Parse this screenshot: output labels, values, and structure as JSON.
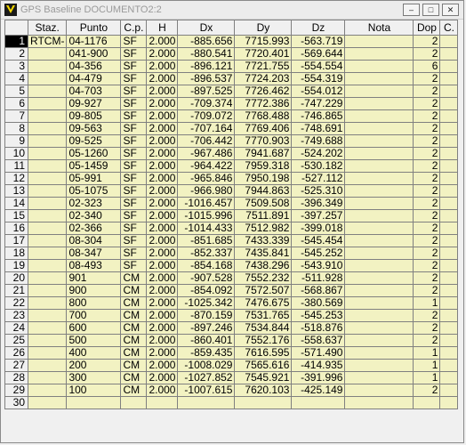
{
  "window": {
    "title": "GPS Baseline DOCUMENTO2:2"
  },
  "titlebar_buttons": {
    "minimize": "–",
    "restore": "□",
    "close": "✕"
  },
  "table": {
    "columns": [
      "",
      "Staz.",
      "Punto",
      "C.p.",
      "H",
      "Dx",
      "Dy",
      "Dz",
      "Nota",
      "Dop",
      "C."
    ],
    "rows": [
      {
        "n": "1",
        "staz": "RTCM-",
        "punto": "04-1176",
        "cp": "SF",
        "h": "2.000",
        "dx": "-885.656",
        "dy": "7715.993",
        "dz": "-563.719",
        "nota": "",
        "dop": "2",
        "c": ""
      },
      {
        "n": "2",
        "staz": "",
        "punto": "041-900",
        "cp": "SF",
        "h": "2.000",
        "dx": "-880.541",
        "dy": "7720.401",
        "dz": "-569.644",
        "nota": "",
        "dop": "2",
        "c": ""
      },
      {
        "n": "3",
        "staz": "",
        "punto": "04-356",
        "cp": "SF",
        "h": "2.000",
        "dx": "-896.121",
        "dy": "7721.755",
        "dz": "-554.554",
        "nota": "",
        "dop": "6",
        "c": ""
      },
      {
        "n": "4",
        "staz": "",
        "punto": "04-479",
        "cp": "SF",
        "h": "2.000",
        "dx": "-896.537",
        "dy": "7724.203",
        "dz": "-554.319",
        "nota": "",
        "dop": "2",
        "c": ""
      },
      {
        "n": "5",
        "staz": "",
        "punto": "04-703",
        "cp": "SF",
        "h": "2.000",
        "dx": "-897.525",
        "dy": "7726.462",
        "dz": "-554.012",
        "nota": "",
        "dop": "2",
        "c": ""
      },
      {
        "n": "6",
        "staz": "",
        "punto": "09-927",
        "cp": "SF",
        "h": "2.000",
        "dx": "-709.374",
        "dy": "7772.386",
        "dz": "-747.229",
        "nota": "",
        "dop": "2",
        "c": ""
      },
      {
        "n": "7",
        "staz": "",
        "punto": "09-805",
        "cp": "SF",
        "h": "2.000",
        "dx": "-709.072",
        "dy": "7768.488",
        "dz": "-746.865",
        "nota": "",
        "dop": "2",
        "c": ""
      },
      {
        "n": "8",
        "staz": "",
        "punto": "09-563",
        "cp": "SF",
        "h": "2.000",
        "dx": "-707.164",
        "dy": "7769.406",
        "dz": "-748.691",
        "nota": "",
        "dop": "2",
        "c": ""
      },
      {
        "n": "9",
        "staz": "",
        "punto": "09-525",
        "cp": "SF",
        "h": "2.000",
        "dx": "-706.442",
        "dy": "7770.903",
        "dz": "-749.688",
        "nota": "",
        "dop": "2",
        "c": ""
      },
      {
        "n": "10",
        "staz": "",
        "punto": "05-1260",
        "cp": "SF",
        "h": "2.000",
        "dx": "-967.486",
        "dy": "7941.687",
        "dz": "-524.202",
        "nota": "",
        "dop": "2",
        "c": ""
      },
      {
        "n": "11",
        "staz": "",
        "punto": "05-1459",
        "cp": "SF",
        "h": "2.000",
        "dx": "-964.422",
        "dy": "7959.318",
        "dz": "-530.182",
        "nota": "",
        "dop": "2",
        "c": ""
      },
      {
        "n": "12",
        "staz": "",
        "punto": "05-991",
        "cp": "SF",
        "h": "2.000",
        "dx": "-965.846",
        "dy": "7950.198",
        "dz": "-527.112",
        "nota": "",
        "dop": "2",
        "c": ""
      },
      {
        "n": "13",
        "staz": "",
        "punto": "05-1075",
        "cp": "SF",
        "h": "2.000",
        "dx": "-966.980",
        "dy": "7944.863",
        "dz": "-525.310",
        "nota": "",
        "dop": "2",
        "c": ""
      },
      {
        "n": "14",
        "staz": "",
        "punto": "02-323",
        "cp": "SF",
        "h": "2.000",
        "dx": "-1016.457",
        "dy": "7509.508",
        "dz": "-396.349",
        "nota": "",
        "dop": "2",
        "c": ""
      },
      {
        "n": "15",
        "staz": "",
        "punto": "02-340",
        "cp": "SF",
        "h": "2.000",
        "dx": "-1015.996",
        "dy": "7511.891",
        "dz": "-397.257",
        "nota": "",
        "dop": "2",
        "c": ""
      },
      {
        "n": "16",
        "staz": "",
        "punto": "02-366",
        "cp": "SF",
        "h": "2.000",
        "dx": "-1014.433",
        "dy": "7512.982",
        "dz": "-399.018",
        "nota": "",
        "dop": "2",
        "c": ""
      },
      {
        "n": "17",
        "staz": "",
        "punto": "08-304",
        "cp": "SF",
        "h": "2.000",
        "dx": "-851.685",
        "dy": "7433.339",
        "dz": "-545.454",
        "nota": "",
        "dop": "2",
        "c": ""
      },
      {
        "n": "18",
        "staz": "",
        "punto": "08-347",
        "cp": "SF",
        "h": "2.000",
        "dx": "-852.337",
        "dy": "7435.841",
        "dz": "-545.252",
        "nota": "",
        "dop": "2",
        "c": ""
      },
      {
        "n": "19",
        "staz": "",
        "punto": "08-493",
        "cp": "SF",
        "h": "2.000",
        "dx": "-854.168",
        "dy": "7438.296",
        "dz": "-543.910",
        "nota": "",
        "dop": "2",
        "c": ""
      },
      {
        "n": "20",
        "staz": "",
        "punto": "901",
        "cp": "CM",
        "h": "2.000",
        "dx": "-907.528",
        "dy": "7552.232",
        "dz": "-511.928",
        "nota": "",
        "dop": "2",
        "c": ""
      },
      {
        "n": "21",
        "staz": "",
        "punto": "900",
        "cp": "CM",
        "h": "2.000",
        "dx": "-854.092",
        "dy": "7572.507",
        "dz": "-568.867",
        "nota": "",
        "dop": "2",
        "c": ""
      },
      {
        "n": "22",
        "staz": "",
        "punto": "800",
        "cp": "CM",
        "h": "2.000",
        "dx": "-1025.342",
        "dy": "7476.675",
        "dz": "-380.569",
        "nota": "",
        "dop": "1",
        "c": ""
      },
      {
        "n": "23",
        "staz": "",
        "punto": "700",
        "cp": "CM",
        "h": "2.000",
        "dx": "-870.159",
        "dy": "7531.765",
        "dz": "-545.253",
        "nota": "",
        "dop": "2",
        "c": ""
      },
      {
        "n": "24",
        "staz": "",
        "punto": "600",
        "cp": "CM",
        "h": "2.000",
        "dx": "-897.246",
        "dy": "7534.844",
        "dz": "-518.876",
        "nota": "",
        "dop": "2",
        "c": ""
      },
      {
        "n": "25",
        "staz": "",
        "punto": "500",
        "cp": "CM",
        "h": "2.000",
        "dx": "-860.401",
        "dy": "7552.176",
        "dz": "-558.637",
        "nota": "",
        "dop": "2",
        "c": ""
      },
      {
        "n": "26",
        "staz": "",
        "punto": "400",
        "cp": "CM",
        "h": "2.000",
        "dx": "-859.435",
        "dy": "7616.595",
        "dz": "-571.490",
        "nota": "",
        "dop": "1",
        "c": ""
      },
      {
        "n": "27",
        "staz": "",
        "punto": "200",
        "cp": "CM",
        "h": "2.000",
        "dx": "-1008.029",
        "dy": "7565.616",
        "dz": "-414.935",
        "nota": "",
        "dop": "1",
        "c": ""
      },
      {
        "n": "28",
        "staz": "",
        "punto": "300",
        "cp": "CM",
        "h": "2.000",
        "dx": "-1027.852",
        "dy": "7545.921",
        "dz": "-391.996",
        "nota": "",
        "dop": "1",
        "c": ""
      },
      {
        "n": "29",
        "staz": "",
        "punto": "100",
        "cp": "CM",
        "h": "2.000",
        "dx": "-1007.615",
        "dy": "7620.103",
        "dz": "-425.149",
        "nota": "",
        "dop": "2",
        "c": ""
      },
      {
        "n": "30",
        "staz": "",
        "punto": "",
        "cp": "",
        "h": "",
        "dx": "",
        "dy": "",
        "dz": "",
        "nota": "",
        "dop": "",
        "c": ""
      }
    ]
  }
}
